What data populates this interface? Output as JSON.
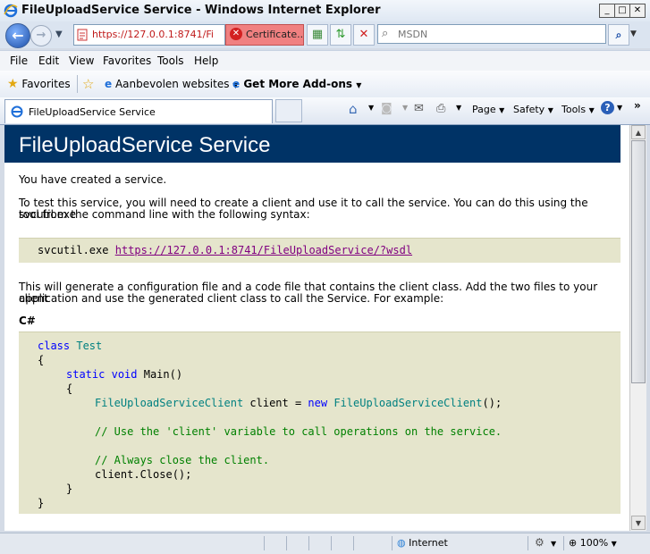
{
  "window": {
    "title": "FileUploadService Service - Windows Internet Explorer",
    "minimize": "_",
    "maximize": "□",
    "close": "✕"
  },
  "address_bar": {
    "url_visible": "https://127.0.0.1:8741/Fi",
    "cert_error_label": "Certificate...",
    "search_placeholder": "MSDN"
  },
  "menu": [
    "File",
    "Edit",
    "View",
    "Favorites",
    "Tools",
    "Help"
  ],
  "favorites_bar": {
    "favorites_label": "Favorites",
    "suggested_sites": "Aanbevolen websites",
    "addons": "Get More Add-ons"
  },
  "tab": {
    "label": "FileUploadService Service"
  },
  "commands": {
    "page": "Page",
    "safety": "Safety",
    "tools": "Tools"
  },
  "page": {
    "heading": "FileUploadService Service",
    "created": "You have created a service.",
    "intro_1": "To test this service, you will need to create a client and use it to call the service. You can do this using the svcutil.exe",
    "intro_2": "tool from the command line with the following syntax:",
    "svcutil_cmd": "svcutil.exe",
    "svcutil_url": "https://127.0.0.1:8741/FileUploadService/?wsdl",
    "generate_1": "This will generate a configuration file and a code file that contains the client class. Add the two files to your client",
    "generate_2": "application and use the generated client class to call the Service. For example:",
    "lang_label": "C#",
    "code": {
      "l1_kw": "class",
      "l1_ty": "Test",
      "l2": "{",
      "l3_kw1": "static",
      "l3_kw2": "void",
      "l3_rest": "Main()",
      "l4": "{",
      "l5_ty1": "FileUploadServiceClient",
      "l5_mid": " client = ",
      "l5_kw": "new",
      "l5_ty2": "FileUploadServiceClient",
      "l5_end": "();",
      "l6": "// Use the 'client' variable to call operations on the service.",
      "l7": "// Always close the client.",
      "l8": "client.Close();",
      "l9": "}",
      "l10": "}"
    }
  },
  "status_bar": {
    "zone": "Internet",
    "zoom": "100%"
  },
  "colors": {
    "header_bg": "#003366",
    "code_bg": "#e5e5cc",
    "keyword": "#0000ff",
    "type": "#008080",
    "comment": "#008000",
    "link": "#800080"
  }
}
